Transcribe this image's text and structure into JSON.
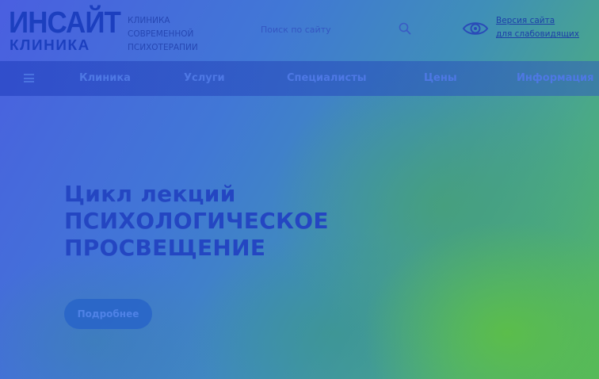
{
  "header": {
    "logo_main": "ИНСАЙТ",
    "logo_sub": "КЛИНИКА",
    "tagline_line1": "КЛИНИКА СОВРЕМЕННОЙ",
    "tagline_line2": "ПСИХОТЕРАПИИ",
    "search_placeholder": "Поиск по сайту",
    "low_vision_line1": "Версия сайта",
    "low_vision_line2": "для слабовидящих"
  },
  "nav": {
    "items": [
      {
        "label": "Клиника"
      },
      {
        "label": "Услуги"
      },
      {
        "label": "Специалисты"
      },
      {
        "label": "Цены"
      },
      {
        "label": "Информация"
      }
    ]
  },
  "hero": {
    "title_line1": "Цикл лекций",
    "title_line2": "ПСИХОЛОГИЧЕСКОЕ",
    "title_line3": "ПРОСВЕЩЕНИЕ",
    "button_label": "Подробнее"
  },
  "colors": {
    "brand_blue": "#1c3fbf",
    "overlay_start": "#4a5fe0",
    "overlay_end": "#55b95c"
  },
  "icons": {
    "search": "search-icon",
    "eye": "eye-icon",
    "menu": "menu-icon"
  }
}
